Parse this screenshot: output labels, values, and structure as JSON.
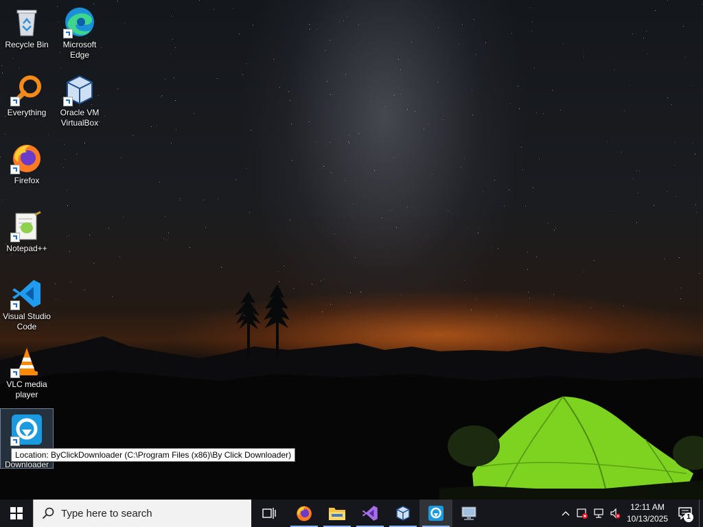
{
  "desktop": {
    "icons": [
      {
        "label": "Recycle Bin",
        "icon": "recycle-bin-icon"
      },
      {
        "label": "Microsoft Edge",
        "icon": "edge-icon"
      },
      {
        "label": "Everything",
        "icon": "everything-search-icon"
      },
      {
        "label": "Oracle VM VirtualBox",
        "icon": "virtualbox-icon"
      },
      {
        "label": "Firefox",
        "icon": "firefox-icon"
      },
      {
        "label": "Notepad++",
        "icon": "notepadpp-icon"
      },
      {
        "label": "Visual Studio Code",
        "icon": "vscode-icon"
      },
      {
        "label": "VLC media player",
        "icon": "vlc-icon"
      },
      {
        "label": "Downloader",
        "icon": "byclickdownloader-icon"
      }
    ],
    "tooltip": "Location: ByClickDownloader (C:\\Program Files (x86)\\By Click Downloader)"
  },
  "taskbar": {
    "search_placeholder": "Type here to search",
    "pinned": [
      "task-view",
      "firefox",
      "file-explorer",
      "visual-studio",
      "virtualbox",
      "byclickdownloader",
      "remote-desktop"
    ],
    "active_app": "byclickdownloader",
    "clock": {
      "time": "12:11 AM",
      "date": "10/13/2025"
    },
    "notification_count": "1"
  },
  "colors": {
    "taskbar_bg": "#16181e",
    "accent": "#8ab4f8",
    "tent_green": "#7ed321",
    "horizon_orange": "#ff7a1e"
  }
}
